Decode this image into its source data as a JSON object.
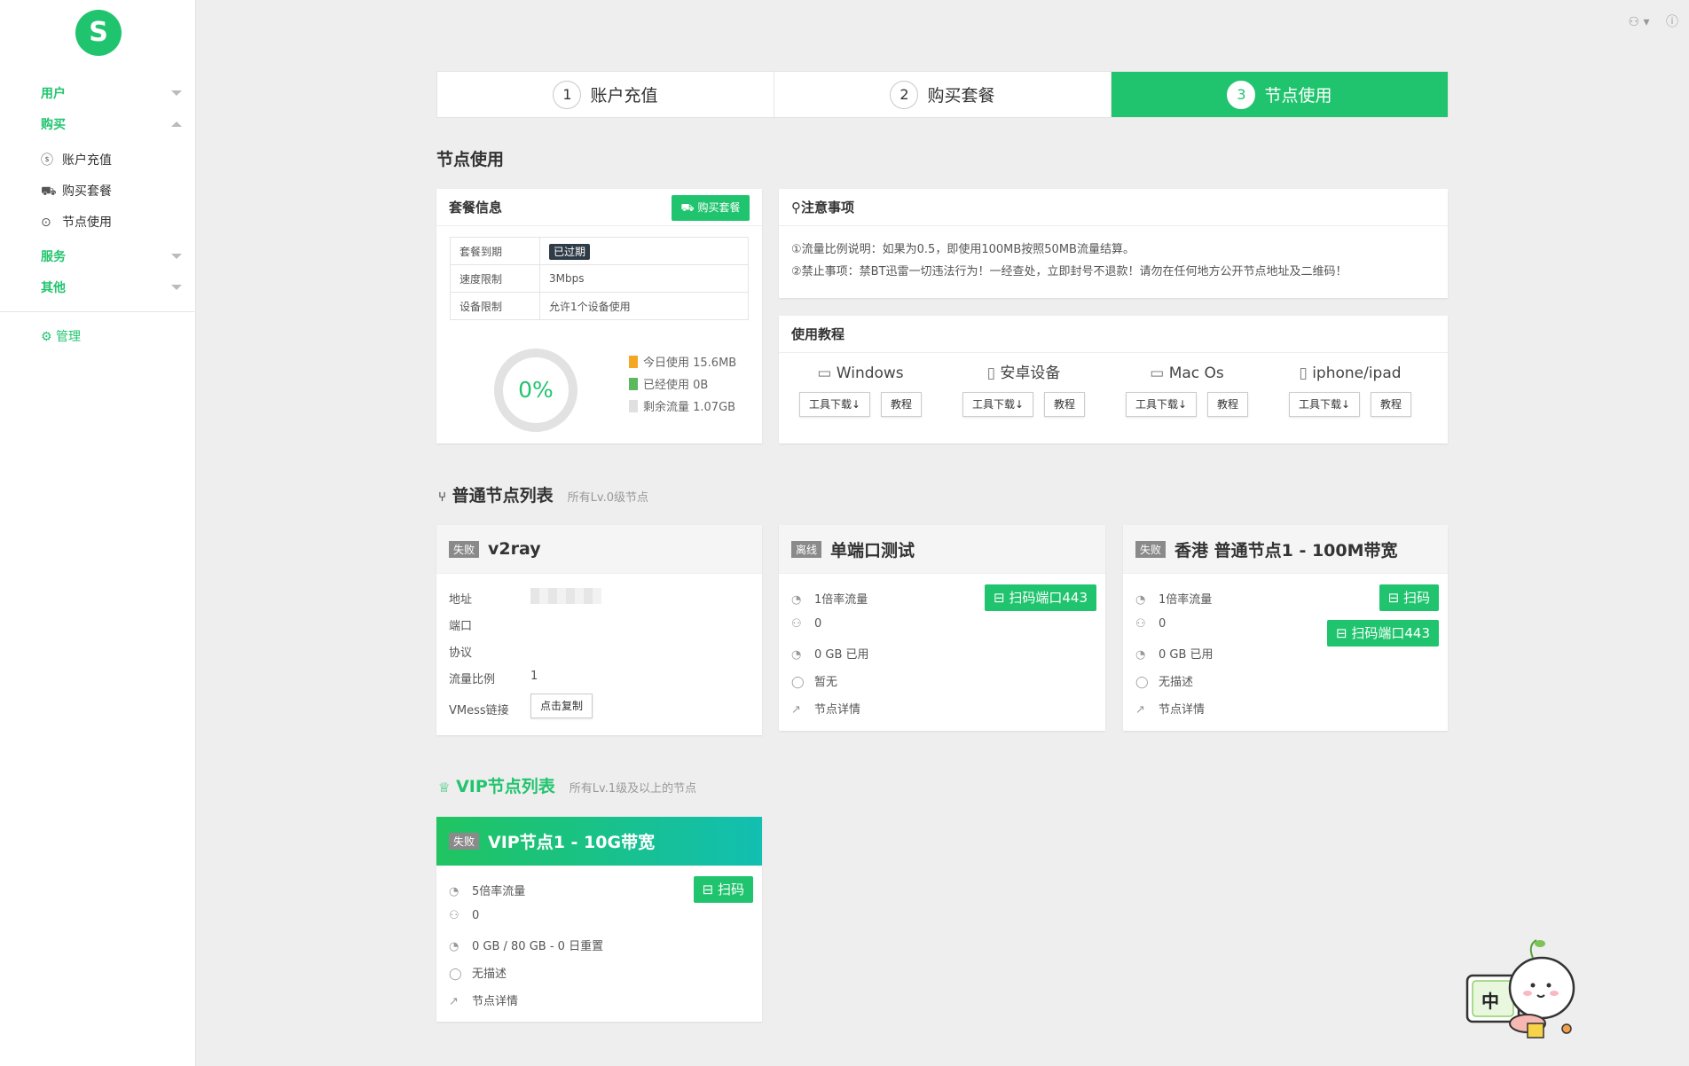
{
  "sidebar": {
    "logo_letter": "S",
    "groups": [
      {
        "label": "用户"
      },
      {
        "label": "购买"
      },
      {
        "label": "服务"
      },
      {
        "label": "其他"
      }
    ],
    "purchase_items": [
      {
        "label": "账户充值",
        "icon": "dollar-circle-icon"
      },
      {
        "label": "购买套餐",
        "icon": "cart-icon"
      },
      {
        "label": "节点使用",
        "icon": "location-pin-icon"
      }
    ],
    "manage_label": "管理"
  },
  "steps": [
    {
      "num": "1",
      "label": "账户充值"
    },
    {
      "num": "2",
      "label": "购买套餐"
    },
    {
      "num": "3",
      "label": "节点使用"
    }
  ],
  "page_title": "节点使用",
  "package": {
    "title": "套餐信息",
    "buy_button": "购买套餐",
    "rows": [
      {
        "k": "套餐到期",
        "v": "已过期"
      },
      {
        "k": "速度限制",
        "v": "3Mbps"
      },
      {
        "k": "设备限制",
        "v": "允许1个设备使用"
      }
    ],
    "usage_percent": "0%",
    "legend": [
      {
        "label": "今日使用 15.6MB",
        "color": "#f5a623"
      },
      {
        "label": "已经使用 0B",
        "color": "#5cb85c"
      },
      {
        "label": "剩余流量 1.07GB",
        "color": "#e0e0e0"
      }
    ]
  },
  "notice": {
    "title": "注意事项",
    "lines": [
      "①流量比例说明：如果为0.5，即使用100MB按照50MB流量结算。",
      "②禁止事项：禁BT迅雷一切违法行为！一经查处，立即封号不退款！请勿在任何地方公开节点地址及二维码！"
    ]
  },
  "tutorial": {
    "title": "使用教程",
    "platforms": [
      {
        "name": "Windows",
        "download": "工具下载↓",
        "guide": "教程"
      },
      {
        "name": "安卓设备",
        "download": "工具下载↓",
        "guide": "教程"
      },
      {
        "name": "Mac Os",
        "download": "工具下载↓",
        "guide": "教程"
      },
      {
        "name": "iphone/ipad",
        "download": "工具下载↓",
        "guide": "教程"
      }
    ]
  },
  "normal_nodes": {
    "title": "普通节点列表",
    "subtitle": "所有Lv.0级节点",
    "v2ray": {
      "status": "失败",
      "name": "v2ray",
      "labels": {
        "address": "地址",
        "port": "端口",
        "protocol": "协议",
        "ratio": "流量比例",
        "vmess": "VMess链接"
      },
      "ratio": "1",
      "copy_button": "点击复制"
    },
    "single": {
      "status": "离线",
      "name": "单端口测试",
      "scan_button": "扫码端口443",
      "rows": [
        "1倍率流量",
        "0",
        "0 GB 已用",
        "暂无",
        "节点详情"
      ]
    },
    "hk": {
      "status": "失败",
      "name": "香港 普通节点1 - 100M带宽",
      "scan_button": "扫码",
      "scan_port_button": "扫码端口443",
      "rows": [
        "1倍率流量",
        "0",
        "0 GB 已用",
        "无描述",
        "节点详情"
      ]
    }
  },
  "vip_nodes": {
    "title": "VIP节点列表",
    "subtitle": "所有Lv.1级及以上的节点",
    "node": {
      "status": "失败",
      "name": "VIP节点1 - 10G带宽",
      "scan_button": "扫码",
      "rows": [
        "5倍率流量",
        "0",
        "0 GB / 80 GB - 0 日重置",
        "无描述",
        "节点详情"
      ]
    }
  },
  "mascot_sign": "中"
}
